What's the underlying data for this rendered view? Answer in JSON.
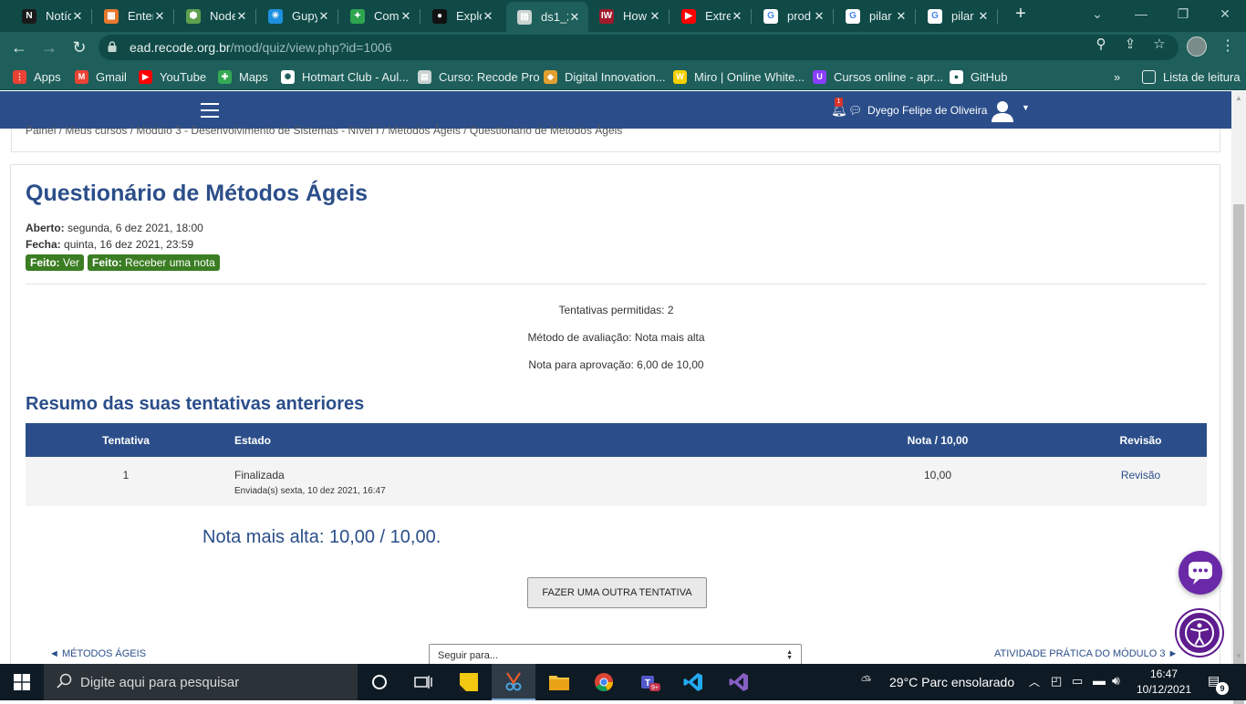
{
  "browser": {
    "tabs": [
      {
        "label": "Notíc",
        "color": "#1a1a1a",
        "glyph": "N"
      },
      {
        "label": "Enter",
        "color": "#e8772e",
        "glyph": "▦"
      },
      {
        "label": "Node",
        "color": "#5fa04e",
        "glyph": "⬢"
      },
      {
        "label": "Gupy",
        "color": "#1e90e0",
        "glyph": "✳"
      },
      {
        "label": "Com",
        "color": "#2ea44f",
        "glyph": "✦"
      },
      {
        "label": "Explo",
        "color": "#111111",
        "glyph": "●"
      },
      {
        "label": "ds1_2",
        "color": "#c9d3d2",
        "glyph": "▤"
      },
      {
        "label": "How",
        "color": "#a01b2b",
        "glyph": "IW"
      },
      {
        "label": "Extre",
        "color": "#ff0000",
        "glyph": "▶"
      },
      {
        "label": "prod",
        "color": "#ffffff",
        "glyph": "G"
      },
      {
        "label": "pilar",
        "color": "#ffffff",
        "glyph": "G"
      },
      {
        "label": "pilar",
        "color": "#ffffff",
        "glyph": "G"
      }
    ],
    "active_tab_index": 6,
    "url_host": "ead.recode.org.br",
    "url_path": "/mod/quiz/view.php?id=1006",
    "bookmarks": [
      {
        "label": "Apps",
        "color": "#e94235",
        "glyph": "⋮"
      },
      {
        "label": "Gmail",
        "color": "#ea4335",
        "glyph": "M"
      },
      {
        "label": "YouTube",
        "color": "#ff0000",
        "glyph": "▶"
      },
      {
        "label": "Maps",
        "color": "#34a853",
        "glyph": "✚"
      },
      {
        "label": "Hotmart Club - Aul...",
        "color": "#ffffff",
        "glyph": "✺"
      },
      {
        "label": "Curso: Recode Pro",
        "color": "#c9d3d2",
        "glyph": "▤"
      },
      {
        "label": "Digital Innovation...",
        "color": "#e0a030",
        "glyph": "◆"
      },
      {
        "label": "Miro | Online White...",
        "color": "#f5d000",
        "glyph": "W"
      },
      {
        "label": "Cursos online - apr...",
        "color": "#8a3ffc",
        "glyph": "U"
      },
      {
        "label": "GitHub",
        "color": "#ffffff",
        "glyph": "●"
      }
    ],
    "reading_list": "Lista de leitura"
  },
  "site": {
    "notification_count": "1",
    "user_name": "Dyego Felipe de Oliveira",
    "breadcrumb": "Painel / Meus cursos / Módulo 3 - Desenvolvimento de Sistemas - Nível I / Métodos Ágeis / Questionário de Métodos Ágeis"
  },
  "quiz": {
    "title": "Questionário de Métodos Ágeis",
    "opened_label": "Aberto:",
    "opened_value": "segunda, 6 dez 2021, 18:00",
    "closes_label": "Fecha:",
    "closes_value": "quinta, 16 dez 2021, 23:59",
    "done_prefix": "Feito:",
    "done_view": "Ver",
    "done_grade": "Receber uma nota",
    "attempts_allowed": "Tentativas permitidas: 2",
    "grading_method": "Método de avaliação: Nota mais alta",
    "pass_grade": "Nota para aprovação: 6,00 de 10,00",
    "summary_title": "Resumo das suas tentativas anteriores",
    "table": {
      "headers": [
        "Tentativa",
        "Estado",
        "Nota / 10,00",
        "Revisão"
      ],
      "rows": [
        {
          "attempt": "1",
          "state": "Finalizada",
          "submitted": "Enviada(s) sexta, 10 dez 2021, 16:47",
          "grade": "10,00",
          "review": "Revisão"
        }
      ]
    },
    "highest_grade": "Nota mais alta: 10,00 / 10,00.",
    "retry_button": "FAZER UMA OUTRA TENTATIVA",
    "prev_activity": "◄ MÉTODOS ÁGEIS",
    "jump_to": "Seguir para...",
    "next_activity": "ATIVIDADE PRÁTICA DO MÓDULO 3 ►"
  },
  "taskbar": {
    "search_placeholder": "Digite aqui para pesquisar",
    "weather": "29°C  Parc ensolarado",
    "time": "16:47",
    "date": "10/12/2021",
    "notifications": "9",
    "teams_badge": "9+"
  },
  "colors": {
    "brand": "#2b4e8a",
    "success": "#3b7d23",
    "chrome": "#1e5f5b"
  }
}
